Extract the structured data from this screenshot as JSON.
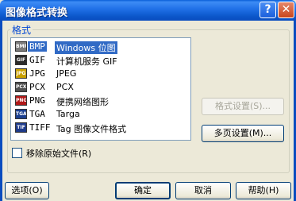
{
  "window": {
    "title": "图像格式转换",
    "help_glyph": "?",
    "close_glyph": "✕"
  },
  "group": {
    "label": "格式"
  },
  "formats": [
    {
      "icon": "BMP",
      "ext": "BMP",
      "desc": "Windows 位图",
      "selected": true,
      "icon_color": "#7a7a7a"
    },
    {
      "icon": "GIF",
      "ext": "GIF",
      "desc": "计算机服务 GIF",
      "selected": false,
      "icon_color": "#2b2b2b"
    },
    {
      "icon": "JPG",
      "ext": "JPG",
      "desc": "JPEG",
      "selected": false,
      "icon_color": "#c9a000"
    },
    {
      "icon": "PCX",
      "ext": "PCX",
      "desc": "PCX",
      "selected": false,
      "icon_color": "#505050"
    },
    {
      "icon": "PNG",
      "ext": "PNG",
      "desc": "便携网络图形",
      "selected": false,
      "icon_color": "#b01818"
    },
    {
      "icon": "TGA",
      "ext": "TGA",
      "desc": "Targa",
      "selected": false,
      "icon_color": "#1b3f8f"
    },
    {
      "icon": "TIF",
      "ext": "TIFF",
      "desc": "Tag 图像文件格式",
      "selected": false,
      "icon_color": "#1e3a8a"
    }
  ],
  "buttons": {
    "format_settings": "格式设置(S)...",
    "multipage_settings": "多页设置(M)...",
    "options": "选项(O)",
    "ok": "确定",
    "cancel": "取消",
    "help": "帮助(H)"
  },
  "checkbox": {
    "label": "移除原始文件(R)",
    "checked": false
  }
}
